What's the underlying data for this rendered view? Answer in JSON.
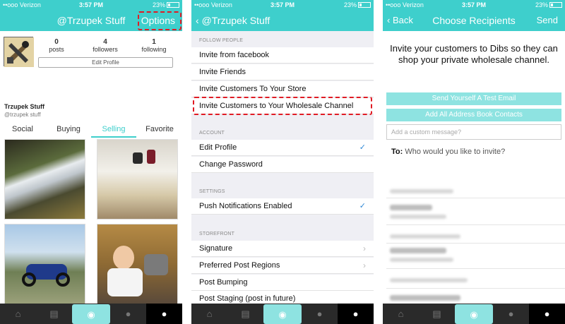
{
  "status": {
    "carrier": "••ooo Verizon",
    "time": "3:57 PM",
    "battery": "23%"
  },
  "profile": {
    "title": "@Trzupek Stuff",
    "options": "Options",
    "stats": [
      {
        "value": "0",
        "label": "posts"
      },
      {
        "value": "4",
        "label": "followers"
      },
      {
        "value": "1",
        "label": "following"
      }
    ],
    "edit_profile": "Edit Profile",
    "name": "Trzupek Stuff",
    "handle": "@trzupek stuff",
    "tabs": [
      "Social",
      "Buying",
      "Selling",
      "Favorite"
    ],
    "active_tab": "Selling"
  },
  "settings": {
    "back_title": "@Trzupek Stuff",
    "sections": {
      "follow": "FOLLOW PEOPLE",
      "account": "ACCOUNT",
      "settings": "SETTINGS",
      "storefront": "STOREFRONT"
    },
    "follow_items": [
      "Invite from facebook",
      "Invite Friends",
      "Invite Customers To Your Store",
      "Invite Customers to Your Wholesale Channel"
    ],
    "account_items": [
      "Edit Profile",
      "Change Password"
    ],
    "settings_items": [
      "Push Notifications Enabled"
    ],
    "storefront_items": [
      "Signature",
      "Preferred Post Regions",
      "Post Bumping",
      "Post Staging (post in future)"
    ],
    "check": "✓",
    "chevron": "›"
  },
  "recipients": {
    "back": "Back",
    "title": "Choose Recipients",
    "send": "Send",
    "invite_text": "Invite your customers to Dibs so they can shop your private wholesale channel.",
    "test_email": "Send Yourself A Test Email",
    "add_all": "Add All Address Book Contacts",
    "message_placeholder": "Add a custom message?",
    "to_label": "To:",
    "to_prompt": "Who would you like to invite?"
  },
  "tabbar_icons": [
    "home-icon",
    "grid-icon",
    "camera-icon",
    "globe-icon",
    "user-icon"
  ],
  "colors": {
    "accent": "#3ecfcc",
    "highlight": "#e01b24"
  }
}
